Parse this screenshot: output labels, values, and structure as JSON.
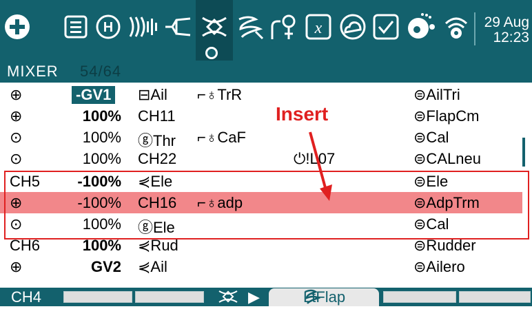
{
  "topbar": {
    "icons": [
      "plus-circle-icon",
      "list-icon",
      "heli-icon",
      "signal-waves-icon",
      "curve-icon",
      "mixer-icon",
      "scribble-icon",
      "input-switch-icon",
      "x-box-icon",
      "cloud-icon",
      "check-box-icon",
      "dots-ball-icon",
      "wifi-icon"
    ],
    "date": "29 Aug",
    "time": "12:23"
  },
  "mixer": {
    "title": "MIXER",
    "count": "54/64"
  },
  "rows": [
    {
      "src": "⊕",
      "weight": "-GV1",
      "weight_style": "highlight",
      "input": "⊟Ail",
      "switch": "⌐♁TrR",
      "extra": "",
      "name": "⊜AilTri"
    },
    {
      "src": "⊕",
      "weight": "100%",
      "weight_style": "bold",
      "input": "CH11",
      "switch": "",
      "extra": "",
      "name": "⊜FlapCm"
    },
    {
      "src": "⊙",
      "weight": "100%",
      "weight_style": "normal",
      "input": "ⓖThr",
      "switch": "⌐♁CaF",
      "extra": "",
      "name": "⊜Cal"
    },
    {
      "src": "⊙",
      "weight": "100%",
      "weight_style": "normal",
      "input": "CH22",
      "switch": "",
      "extra": "⏻!L07",
      "name": "⊜CALneu"
    },
    {
      "src": "CH5",
      "weight": "-100%",
      "weight_style": "bold",
      "input": "⋞Ele",
      "switch": "",
      "extra": "",
      "name": "⊜Ele"
    },
    {
      "src": "⊕",
      "weight": "-100%",
      "weight_style": "normal",
      "input": "CH16",
      "switch": "⌐♁adp",
      "extra": "",
      "name": "⊜AdpTrm"
    },
    {
      "src": "⊙",
      "weight": "100%",
      "weight_style": "normal",
      "input": "ⓖEle",
      "switch": "",
      "extra": "",
      "name": "⊜Cal"
    },
    {
      "src": "CH6",
      "weight": "100%",
      "weight_style": "bold",
      "input": "⋞Rud",
      "switch": "",
      "extra": "",
      "name": "⊜Rudder"
    },
    {
      "src": "⊕",
      "weight": "GV2",
      "weight_style": "bold",
      "input": "⋞Ail",
      "switch": "",
      "extra": "",
      "name": "⊜Ailero"
    }
  ],
  "annotation": {
    "label": "Insert"
  },
  "bottombar": {
    "channel": "CH4",
    "next_label": "LtFlap"
  },
  "colors": {
    "teal": "#13616d",
    "selected_row": "#f2878a",
    "annotation": "#e02020"
  }
}
